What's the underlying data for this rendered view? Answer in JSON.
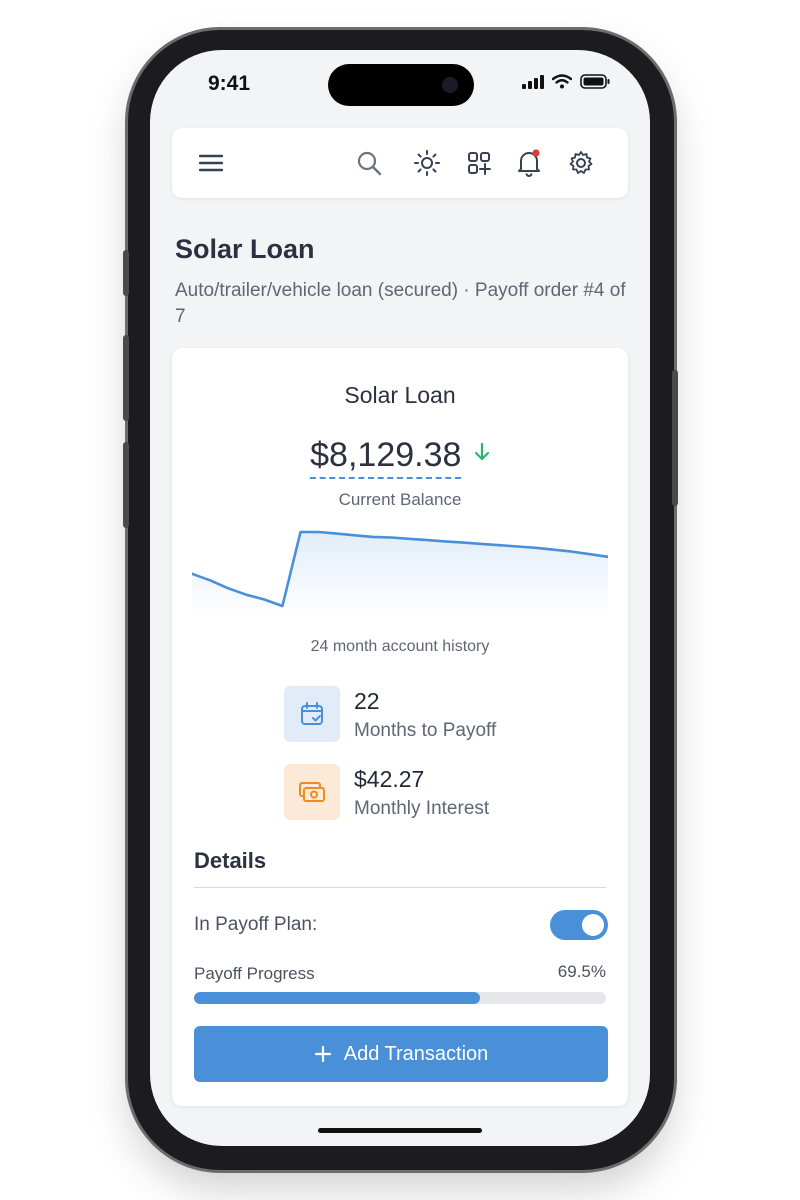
{
  "status": {
    "time": "9:41"
  },
  "colors": {
    "accent": "#4a90d9",
    "down_arrow": "#2bb673",
    "orange": "#f08a24",
    "notification_dot": "#e53935"
  },
  "topbar": {
    "icons": [
      "menu-icon",
      "search-icon",
      "sun-icon",
      "grid-add-icon",
      "bell-icon",
      "gear-icon"
    ]
  },
  "page": {
    "title": "Solar Loan",
    "subtitle": "Auto/trailer/vehicle loan (secured) · Payoff order #4 of 7"
  },
  "card": {
    "title": "Solar Loan",
    "balance": "$8,129.38",
    "balance_label": "Current Balance",
    "chart_caption": "24 month account history"
  },
  "chart_data": {
    "type": "area",
    "title": "",
    "xlabel": "",
    "ylabel": "",
    "x": [
      1,
      2,
      3,
      4,
      5,
      6,
      7,
      8,
      9,
      10,
      11,
      12,
      13,
      14,
      15,
      16,
      17,
      18,
      19,
      20,
      21,
      22,
      23,
      24
    ],
    "values": [
      7650,
      7450,
      7200,
      7000,
      6850,
      6650,
      8950,
      8950,
      8900,
      8850,
      8800,
      8780,
      8740,
      8700,
      8660,
      8620,
      8580,
      8540,
      8500,
      8460,
      8400,
      8340,
      8260,
      8180
    ],
    "ylim": [
      6400,
      9200
    ],
    "grid": false,
    "legend": "none"
  },
  "stats": [
    {
      "value": "22",
      "label": "Months to Payoff",
      "icon": "calendar-check-icon"
    },
    {
      "value": "$42.27",
      "label": "Monthly Interest",
      "icon": "money-icon"
    }
  ],
  "details": {
    "title": "Details",
    "plan_label": "In Payoff Plan:",
    "in_plan": true,
    "progress_label": "Payoff Progress",
    "progress_text": "69.5%",
    "progress_value": 69.5
  },
  "actions": {
    "add_transaction": "Add Transaction"
  }
}
